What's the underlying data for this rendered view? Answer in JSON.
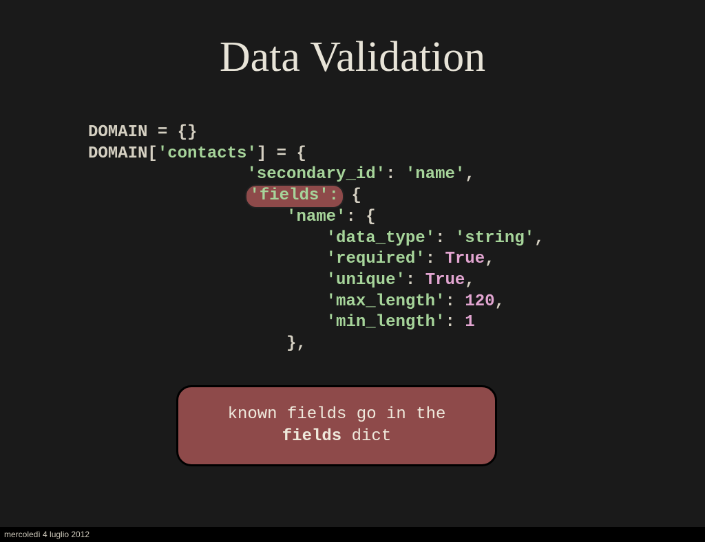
{
  "title": "Data Validation",
  "code": {
    "l1_domain": "DOMAIN",
    "l1_eq_empty": " = {}",
    "l2_domain": "DOMAIN",
    "l2_bracket_open": "[",
    "l2_contacts": "'contacts'",
    "l2_bracket_close_eq": "] = {",
    "l3_secondary": "'secondary_id'",
    "l3_colon_sp": ": ",
    "l3_name": "'name'",
    "l3_comma": ",",
    "l4_fields": "'fields':",
    "l4_brace": " {",
    "l5_name": "'name'",
    "l5_rest": ": {",
    "l6_key": "'data_type'",
    "l6_val": "'string'",
    "l7_key": "'required'",
    "l7_val": "True",
    "l8_key": "'unique'",
    "l8_val": "True",
    "l9_key": "'max_length'",
    "l9_val": "120",
    "l10_key": "'min_length'",
    "l10_val": "1",
    "l11_close": "},",
    "colon_sp": ": ",
    "comma": ","
  },
  "callout": {
    "line1": "known fields go in the",
    "line2_bold": "fields",
    "line2_rest": " dict"
  },
  "footer_date": "mercoledì 4 luglio 2012"
}
